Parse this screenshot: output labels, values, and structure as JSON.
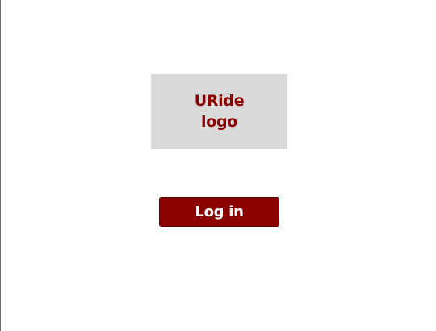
{
  "logo": {
    "text": "URide\nlogo",
    "background_color": "#d9d9d9",
    "text_color": "#8b0000"
  },
  "login": {
    "label": "Log in",
    "background_color": "#8b0000",
    "text_color": "#ffffff"
  }
}
